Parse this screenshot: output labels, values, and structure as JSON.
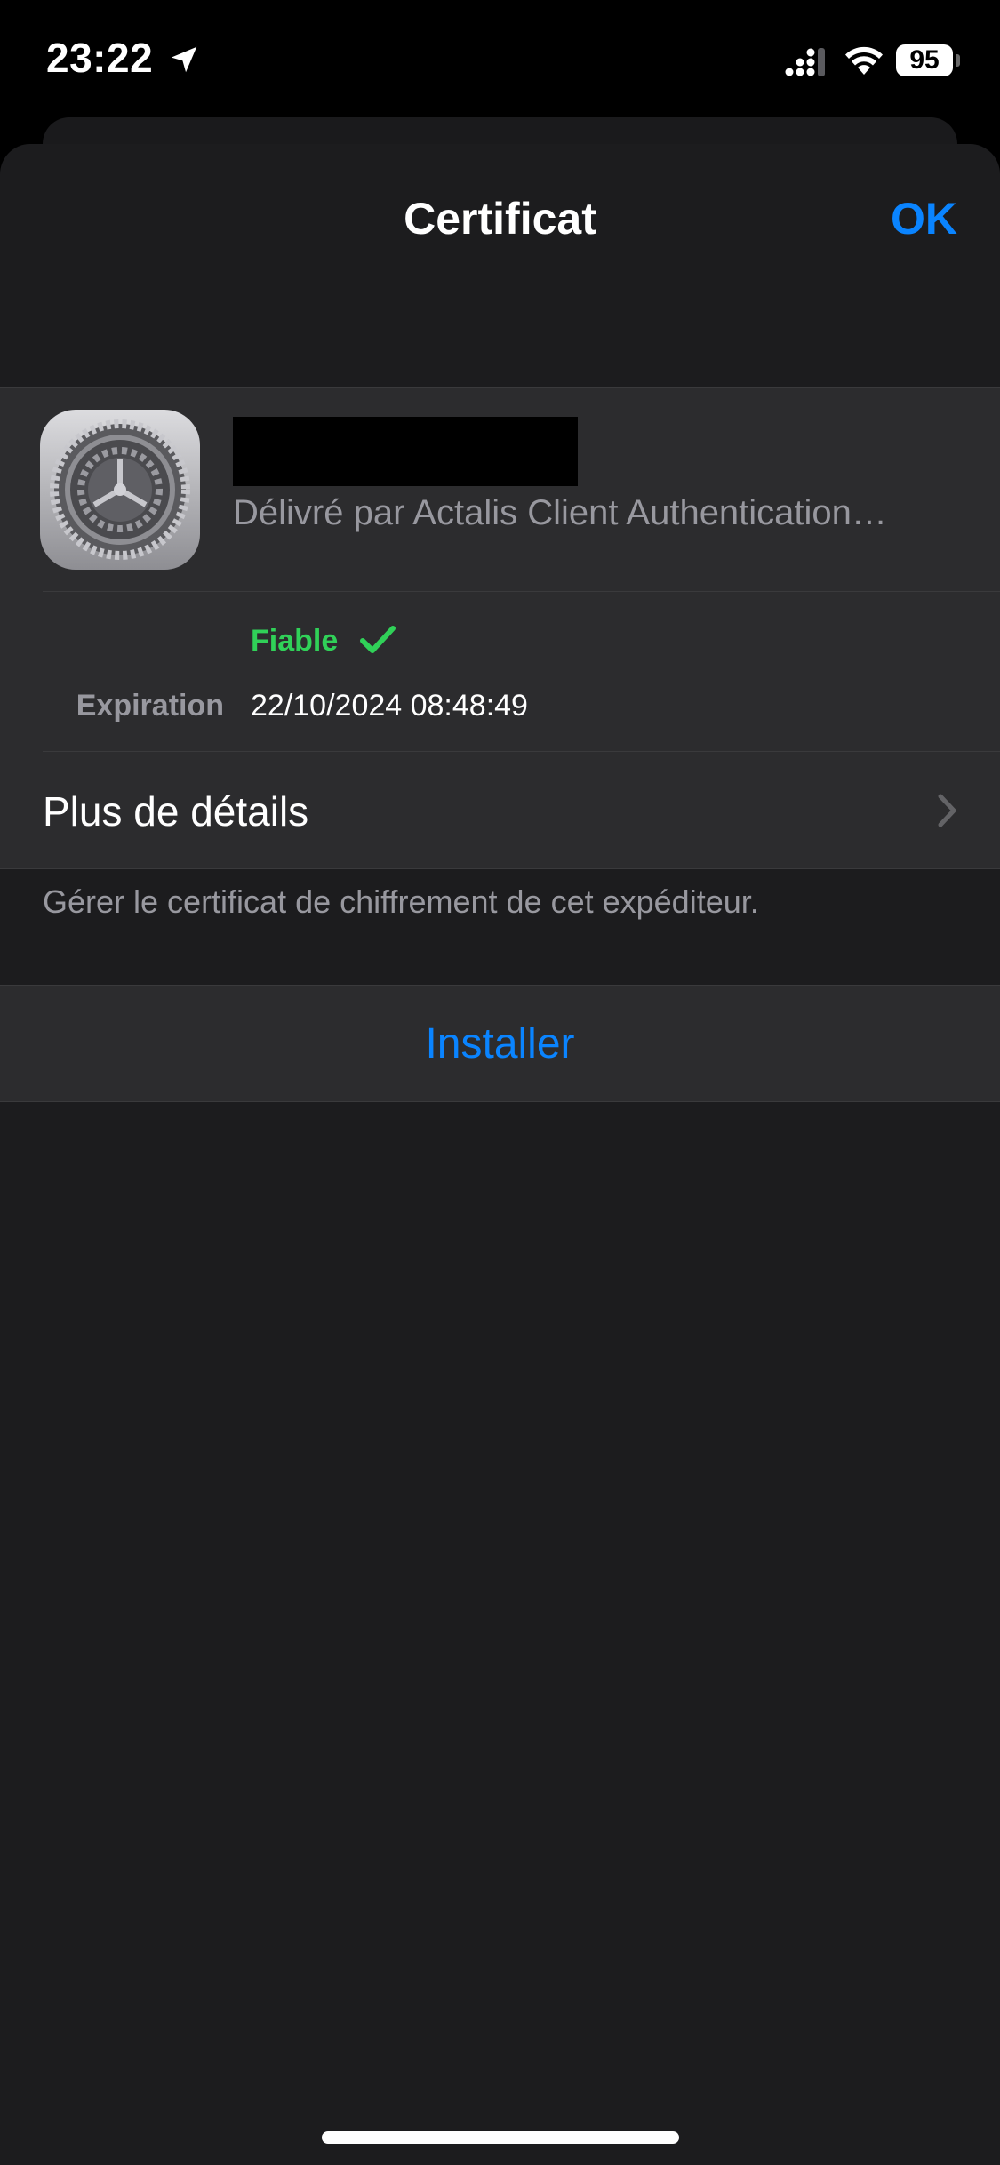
{
  "status_bar": {
    "time": "23:22",
    "battery_level": "95",
    "icons": [
      "location-arrow-icon",
      "cellular-signal-icon",
      "wifi-icon",
      "battery-icon"
    ]
  },
  "nav": {
    "title": "Certificat",
    "done_label": "OK"
  },
  "certificate": {
    "icon": "settings-gear-icon",
    "issuer": "Délivré par Actalis Client Authentication…",
    "trust_status": "Fiable",
    "expiration_label": "Expiration",
    "expiration_value": "22/10/2024 08:48:49",
    "details_label": "Plus de détails"
  },
  "footer_note": "Gérer le certificat de chiffrement de cet expéditeur.",
  "install_label": "Installer",
  "colors": {
    "accent": "#0a84ff",
    "trusted": "#30d158",
    "background": "#1c1c1e",
    "cell": "#2c2c2e",
    "secondary_text": "#98989f"
  }
}
